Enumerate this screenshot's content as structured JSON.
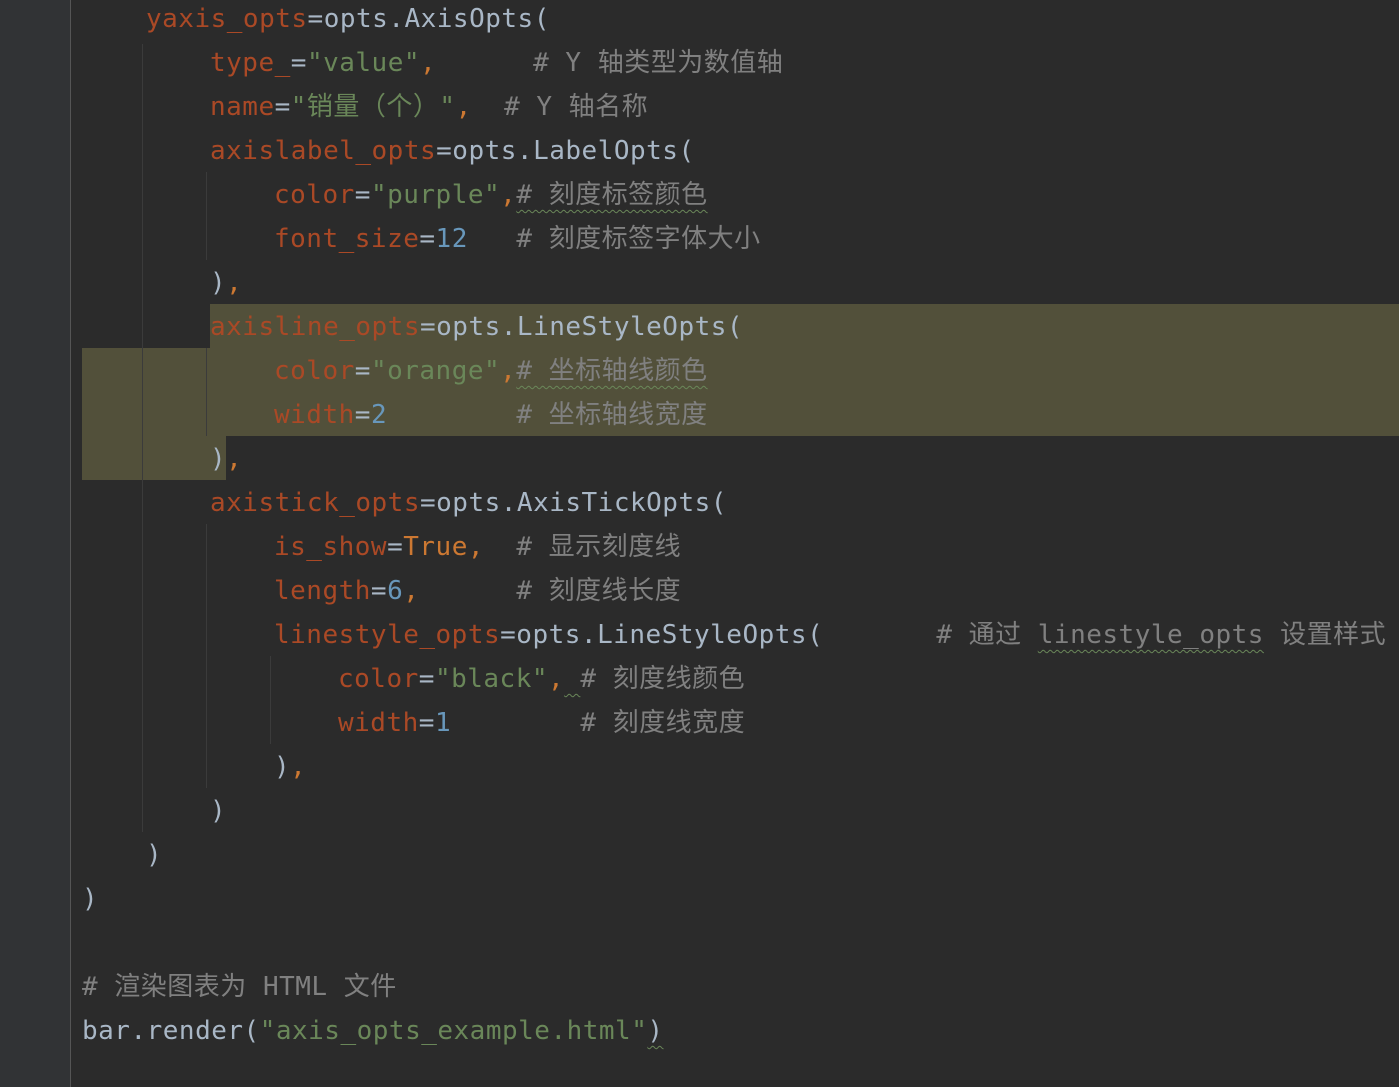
{
  "lines": [
    {
      "indent": 146,
      "tokens": [
        {
          "t": "yaxis_opts",
          "c": "p"
        },
        {
          "t": "=opts.AxisOpts(",
          "c": "d"
        }
      ]
    },
    {
      "indent": 210,
      "tokens": [
        {
          "t": "type_",
          "c": "p"
        },
        {
          "t": "=",
          "c": "d"
        },
        {
          "t": "\"value\"",
          "c": "s"
        },
        {
          "t": ",",
          "c": "k"
        },
        {
          "t": "      ",
          "c": "d"
        },
        {
          "t": "# Y 轴类型为数值轴",
          "c": "c"
        }
      ]
    },
    {
      "indent": 210,
      "tokens": [
        {
          "t": "name",
          "c": "p"
        },
        {
          "t": "=",
          "c": "d"
        },
        {
          "t": "\"销量（个）\"",
          "c": "s"
        },
        {
          "t": ",",
          "c": "k"
        },
        {
          "t": "  ",
          "c": "d"
        },
        {
          "t": "# Y 轴名称",
          "c": "c"
        }
      ]
    },
    {
      "indent": 210,
      "tokens": [
        {
          "t": "axislabel_opts",
          "c": "p"
        },
        {
          "t": "=opts.LabelOpts(",
          "c": "d"
        }
      ]
    },
    {
      "indent": 274,
      "tokens": [
        {
          "t": "color",
          "c": "p"
        },
        {
          "t": "=",
          "c": "d"
        },
        {
          "t": "\"purple\"",
          "c": "s"
        },
        {
          "t": ",",
          "c": "k"
        },
        {
          "t": "# 刻度标签颜色",
          "c": "c",
          "w": true
        }
      ]
    },
    {
      "indent": 274,
      "tokens": [
        {
          "t": "font_size",
          "c": "p"
        },
        {
          "t": "=",
          "c": "d"
        },
        {
          "t": "12",
          "c": "n"
        },
        {
          "t": "   ",
          "c": "d"
        },
        {
          "t": "# 刻度标签字体大小",
          "c": "c"
        }
      ]
    },
    {
      "indent": 210,
      "tokens": [
        {
          "t": ")",
          "c": "d"
        },
        {
          "t": ",",
          "c": "k"
        }
      ]
    },
    {
      "indent": 210,
      "tokens": [
        {
          "t": "axisline_opts",
          "c": "p"
        },
        {
          "t": "=opts.LineStyleOpts(",
          "c": "d"
        }
      ]
    },
    {
      "indent": 274,
      "tokens": [
        {
          "t": "color",
          "c": "p"
        },
        {
          "t": "=",
          "c": "d"
        },
        {
          "t": "\"orange\"",
          "c": "s"
        },
        {
          "t": ",",
          "c": "k"
        },
        {
          "t": "# 坐标轴线颜色",
          "c": "c",
          "w": true
        }
      ]
    },
    {
      "indent": 274,
      "tokens": [
        {
          "t": "width",
          "c": "p"
        },
        {
          "t": "=",
          "c": "d"
        },
        {
          "t": "2",
          "c": "n"
        },
        {
          "t": "        ",
          "c": "d"
        },
        {
          "t": "# 坐标轴线宽度",
          "c": "c"
        }
      ]
    },
    {
      "indent": 210,
      "tokens": [
        {
          "t": ")",
          "c": "d"
        },
        {
          "t": ",",
          "c": "k"
        }
      ]
    },
    {
      "indent": 210,
      "tokens": [
        {
          "t": "axistick_opts",
          "c": "p"
        },
        {
          "t": "=opts.AxisTickOpts(",
          "c": "d"
        }
      ]
    },
    {
      "indent": 274,
      "tokens": [
        {
          "t": "is_show",
          "c": "p"
        },
        {
          "t": "=",
          "c": "d"
        },
        {
          "t": "True",
          "c": "k"
        },
        {
          "t": ",",
          "c": "k"
        },
        {
          "t": "  ",
          "c": "d"
        },
        {
          "t": "# 显示刻度线",
          "c": "c"
        }
      ]
    },
    {
      "indent": 274,
      "tokens": [
        {
          "t": "length",
          "c": "p"
        },
        {
          "t": "=",
          "c": "d"
        },
        {
          "t": "6",
          "c": "n"
        },
        {
          "t": ",",
          "c": "k"
        },
        {
          "t": "      ",
          "c": "d"
        },
        {
          "t": "# 刻度线长度",
          "c": "c"
        }
      ]
    },
    {
      "indent": 274,
      "tokens": [
        {
          "t": "linestyle_opts",
          "c": "p"
        },
        {
          "t": "=opts.LineStyleOpts(",
          "c": "d"
        },
        {
          "t": "       ",
          "c": "d"
        },
        {
          "t": "# 通过 ",
          "c": "c"
        },
        {
          "t": "linestyle_opts",
          "c": "c",
          "w": true
        },
        {
          "t": " 设置样式",
          "c": "c"
        }
      ]
    },
    {
      "indent": 338,
      "tokens": [
        {
          "t": "color",
          "c": "p"
        },
        {
          "t": "=",
          "c": "d"
        },
        {
          "t": "\"black\"",
          "c": "s"
        },
        {
          "t": ",",
          "c": "k"
        },
        {
          "t": " ",
          "c": "d",
          "w": true
        },
        {
          "t": "# 刻度线颜色",
          "c": "c"
        }
      ]
    },
    {
      "indent": 338,
      "tokens": [
        {
          "t": "width",
          "c": "p"
        },
        {
          "t": "=",
          "c": "d"
        },
        {
          "t": "1",
          "c": "n"
        },
        {
          "t": "        ",
          "c": "d"
        },
        {
          "t": "# 刻度线宽度",
          "c": "c"
        }
      ]
    },
    {
      "indent": 274,
      "tokens": [
        {
          "t": ")",
          "c": "d"
        },
        {
          "t": ",",
          "c": "k"
        }
      ]
    },
    {
      "indent": 210,
      "tokens": [
        {
          "t": ")",
          "c": "d"
        }
      ]
    },
    {
      "indent": 146,
      "tokens": [
        {
          "t": ")",
          "c": "d"
        }
      ]
    },
    {
      "indent": 82,
      "tokens": [
        {
          "t": ")",
          "c": "d"
        }
      ]
    },
    {
      "indent": 82,
      "tokens": []
    },
    {
      "indent": 82,
      "tokens": [
        {
          "t": "# 渲染图表为 HTML 文件",
          "c": "c"
        }
      ]
    },
    {
      "indent": 82,
      "tokens": [
        {
          "t": "bar.render(",
          "c": "d"
        },
        {
          "t": "\"axis_opts_example.html\"",
          "c": "s"
        },
        {
          "t": ")",
          "c": "d",
          "w": true
        }
      ]
    }
  ]
}
